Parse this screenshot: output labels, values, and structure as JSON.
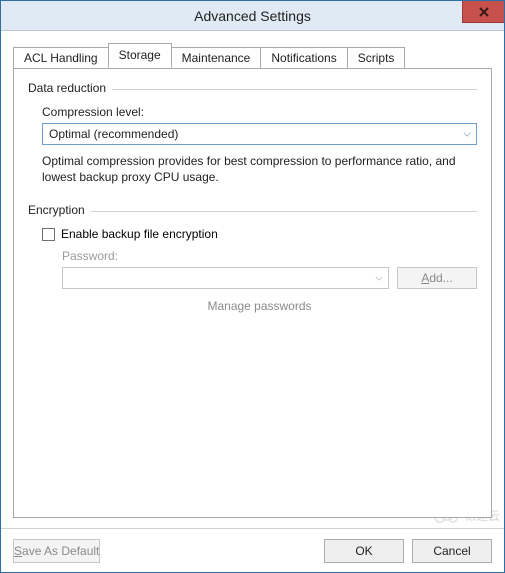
{
  "window": {
    "title": "Advanced Settings"
  },
  "tabs": [
    {
      "label": "ACL Handling"
    },
    {
      "label": "Storage"
    },
    {
      "label": "Maintenance"
    },
    {
      "label": "Notifications"
    },
    {
      "label": "Scripts"
    }
  ],
  "data_reduction": {
    "group_title": "Data reduction",
    "compression_label": "Compression level:",
    "compression_value": "Optimal (recommended)",
    "hint": "Optimal compression provides for best compression to performance ratio, and lowest backup proxy CPU usage."
  },
  "encryption": {
    "group_title": "Encryption",
    "checkbox_label": "Enable backup file encryption",
    "checked": false,
    "password_label": "Password:",
    "password_value": "",
    "add_btn_prefix": "A",
    "add_btn_suffix": "dd...",
    "manage_link": "Manage passwords"
  },
  "footer": {
    "save_default_prefix": "S",
    "save_default_suffix": "ave As Default",
    "ok": "OK",
    "cancel": "Cancel"
  },
  "watermark": {
    "text": "亿速云"
  }
}
